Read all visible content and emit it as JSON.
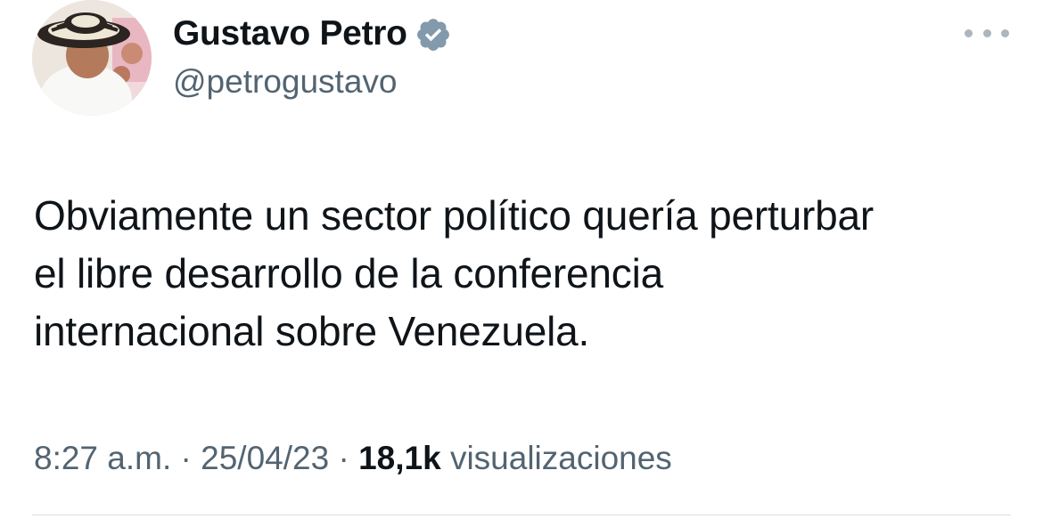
{
  "author": {
    "display_name": "Gustavo Petro",
    "handle": "@petrogustavo",
    "verified": true,
    "verified_color": "#829aab"
  },
  "tweet": {
    "text_lines": [
      "Obviamente un sector político quería perturbar",
      "el libre desarrollo de la conferencia",
      "internacional sobre Venezuela."
    ]
  },
  "meta": {
    "time": "8:27 a.m.",
    "separator": "·",
    "date": "25/04/23",
    "views_count": "18,1k",
    "views_label": "visualizaciones"
  },
  "icons": {
    "more": "more-horizontal-icon",
    "verified": "verified-badge-icon"
  },
  "colors": {
    "text_primary": "#0f1419",
    "text_secondary": "#536471",
    "divider": "#d9dde1"
  }
}
